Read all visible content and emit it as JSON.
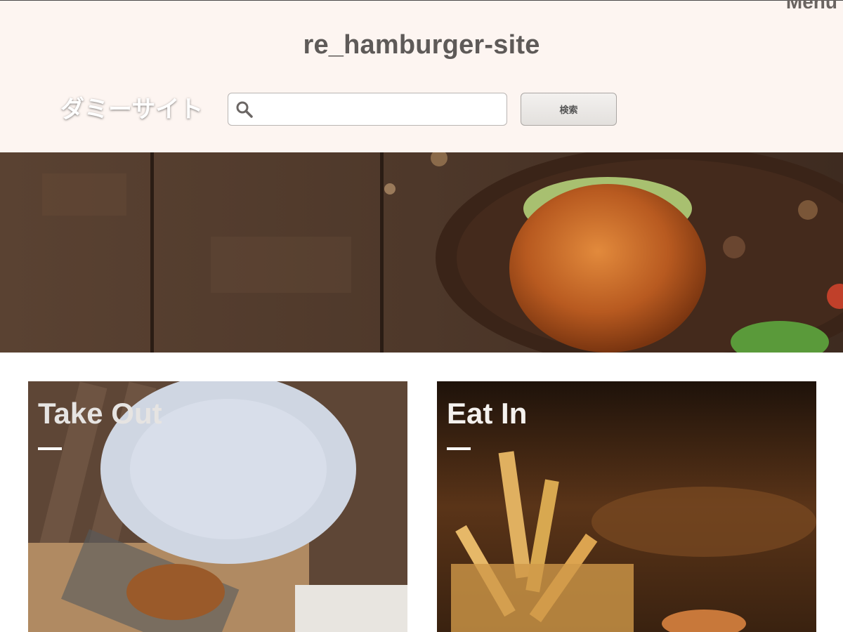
{
  "header": {
    "menu_label": "Menu",
    "site_title": "re_hamburger-site",
    "search": {
      "icon": "magnifier",
      "value": "",
      "placeholder": "",
      "button_label": "検索"
    }
  },
  "hero": {
    "text": "ダミーサイト",
    "image": "hamburger-on-wooden-table"
  },
  "cards": [
    {
      "title": "Take Out",
      "image": "fries-basket-with-plate"
    },
    {
      "title": "Eat In",
      "image": "french-fries-close-up"
    }
  ],
  "colors": {
    "header_bg": "#fdf5f1",
    "title_text": "#5e5a58",
    "hero_text": "#ffffff"
  }
}
